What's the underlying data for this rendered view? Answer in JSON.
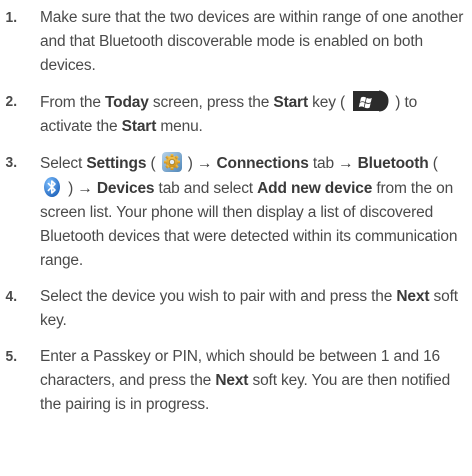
{
  "steps": [
    {
      "number": "1.",
      "parts": [
        "Make sure that the two devices are within range of one another and that Bluetooth discoverable mode is enabled on both devices."
      ]
    },
    {
      "number": "2.",
      "parts": [
        "From the ",
        "Today",
        " screen, press the ",
        "Start",
        " key ( ",
        " ) to activate the ",
        "Start",
        " menu."
      ]
    },
    {
      "number": "3.",
      "parts": [
        "Select ",
        "Settings",
        " ( ",
        " ) ",
        "→ Connections",
        " tab ",
        "→ Bluetooth",
        " ( ",
        " ) ",
        "→ Devices",
        " tab and select ",
        "Add new device",
        " from the on screen list. Your phone will then display a list of discovered Bluetooth devices that were detected within its communication range."
      ]
    },
    {
      "number": "4.",
      "parts": [
        "Select the device you wish to pair with and press the ",
        "Next",
        " soft key."
      ]
    },
    {
      "number": "5.",
      "parts": [
        "Enter a Passkey or PIN, which should be between 1 and 16 characters, and press the ",
        "Next",
        " soft key. You are then notified the pairing is in progress."
      ]
    }
  ],
  "icons": {
    "start_key": "windows-start-key-icon",
    "settings": "settings-gear-icon",
    "bluetooth": "bluetooth-icon"
  },
  "colors": {
    "text": "#4a4a4a",
    "start_key_bg": "#2b2b2b",
    "bluetooth_blue": "#1a73d6"
  }
}
